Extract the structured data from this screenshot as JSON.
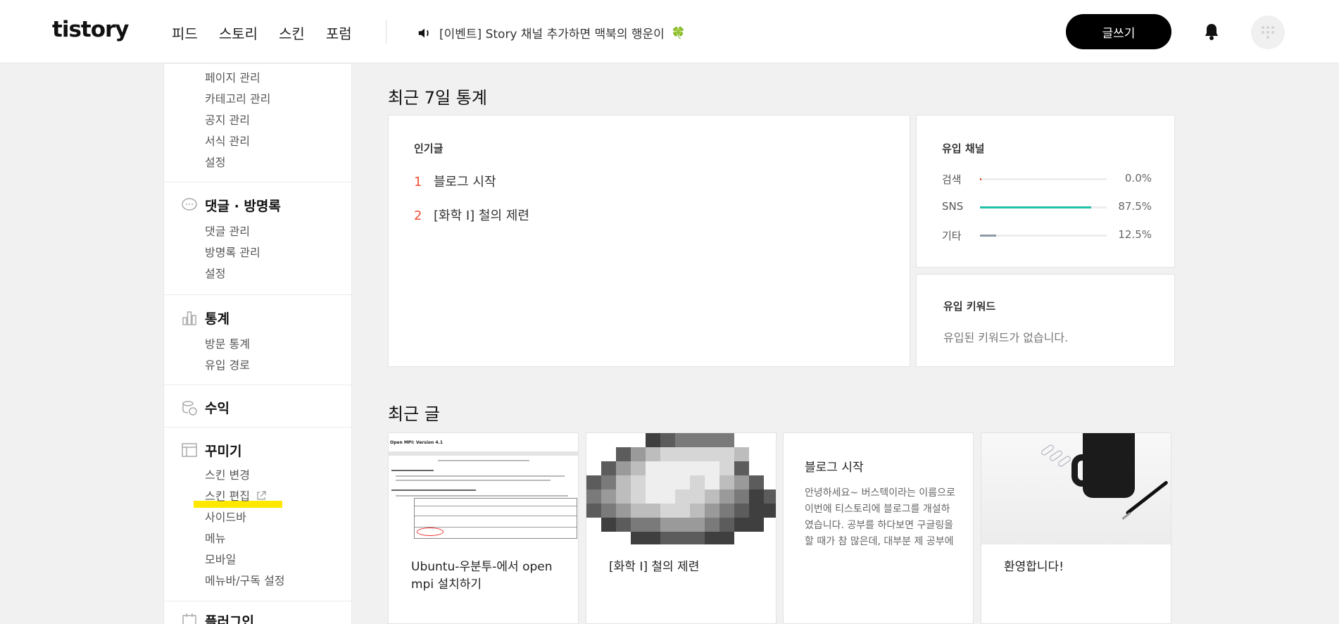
{
  "header": {
    "logo_text": "tistory",
    "nav": [
      "피드",
      "스토리",
      "스킨",
      "포럼"
    ],
    "notice": "[이벤트] Story 채널 추가하면 맥북의 행운이",
    "notice_emoji": "🍀",
    "write_button": "글쓰기"
  },
  "sidebar": {
    "manage_items": [
      "페이지 관리",
      "카테고리 관리",
      "공지 관리",
      "서식 관리",
      "설정"
    ],
    "comments": {
      "title": "댓글 · 방명록",
      "items": [
        "댓글 관리",
        "방명록 관리",
        "설정"
      ]
    },
    "stats": {
      "title": "통계",
      "items": [
        "방문 통계",
        "유입 경로"
      ]
    },
    "revenue": {
      "title": "수익"
    },
    "decorate": {
      "title": "꾸미기",
      "items": [
        "스킨 변경",
        "스킨 편집",
        "사이드바",
        "메뉴",
        "모바일",
        "메뉴바/구독 설정"
      ]
    },
    "plugins": {
      "title": "플러그인"
    }
  },
  "stats7": {
    "title": "최근 7일 통계",
    "popular": {
      "title": "인기글",
      "items": [
        {
          "rank": "1",
          "title": "블로그 시작"
        },
        {
          "rank": "2",
          "title": "[화학 I] 철의 제련"
        }
      ]
    },
    "channels": {
      "title": "유입 채널",
      "items": [
        {
          "label": "검색",
          "value": "0.0%",
          "fraction": 0.0,
          "color": "#ef4e36"
        },
        {
          "label": "SNS",
          "value": "87.5%",
          "fraction": 0.875,
          "color": "#22c0a8"
        },
        {
          "label": "기타",
          "value": "12.5%",
          "fraction": 0.125,
          "color": "#8f9aa6"
        }
      ]
    },
    "keywords": {
      "title": "유입 키워드",
      "empty": "유입된 키워드가 없습니다."
    }
  },
  "recent": {
    "title": "최근 글",
    "posts": [
      {
        "title": "Ubuntu-우분투-에서 open mpi 설치하기",
        "thumb_title": "Open MPI: Version 4.1"
      },
      {
        "title": "[화학 I] 철의 제련"
      },
      {
        "title": "블로그 시작",
        "excerpt": "안녕하세요~ 버스텍이라는 이름으로 이번에 티스토리에 블로그를 개설하였습니다. 공부를 하다보면 구글링을 할 때가 참 많은데, 대부분 제 공부에 실질적으로 도움이 되…"
      },
      {
        "title": "환영합니다!"
      }
    ]
  }
}
